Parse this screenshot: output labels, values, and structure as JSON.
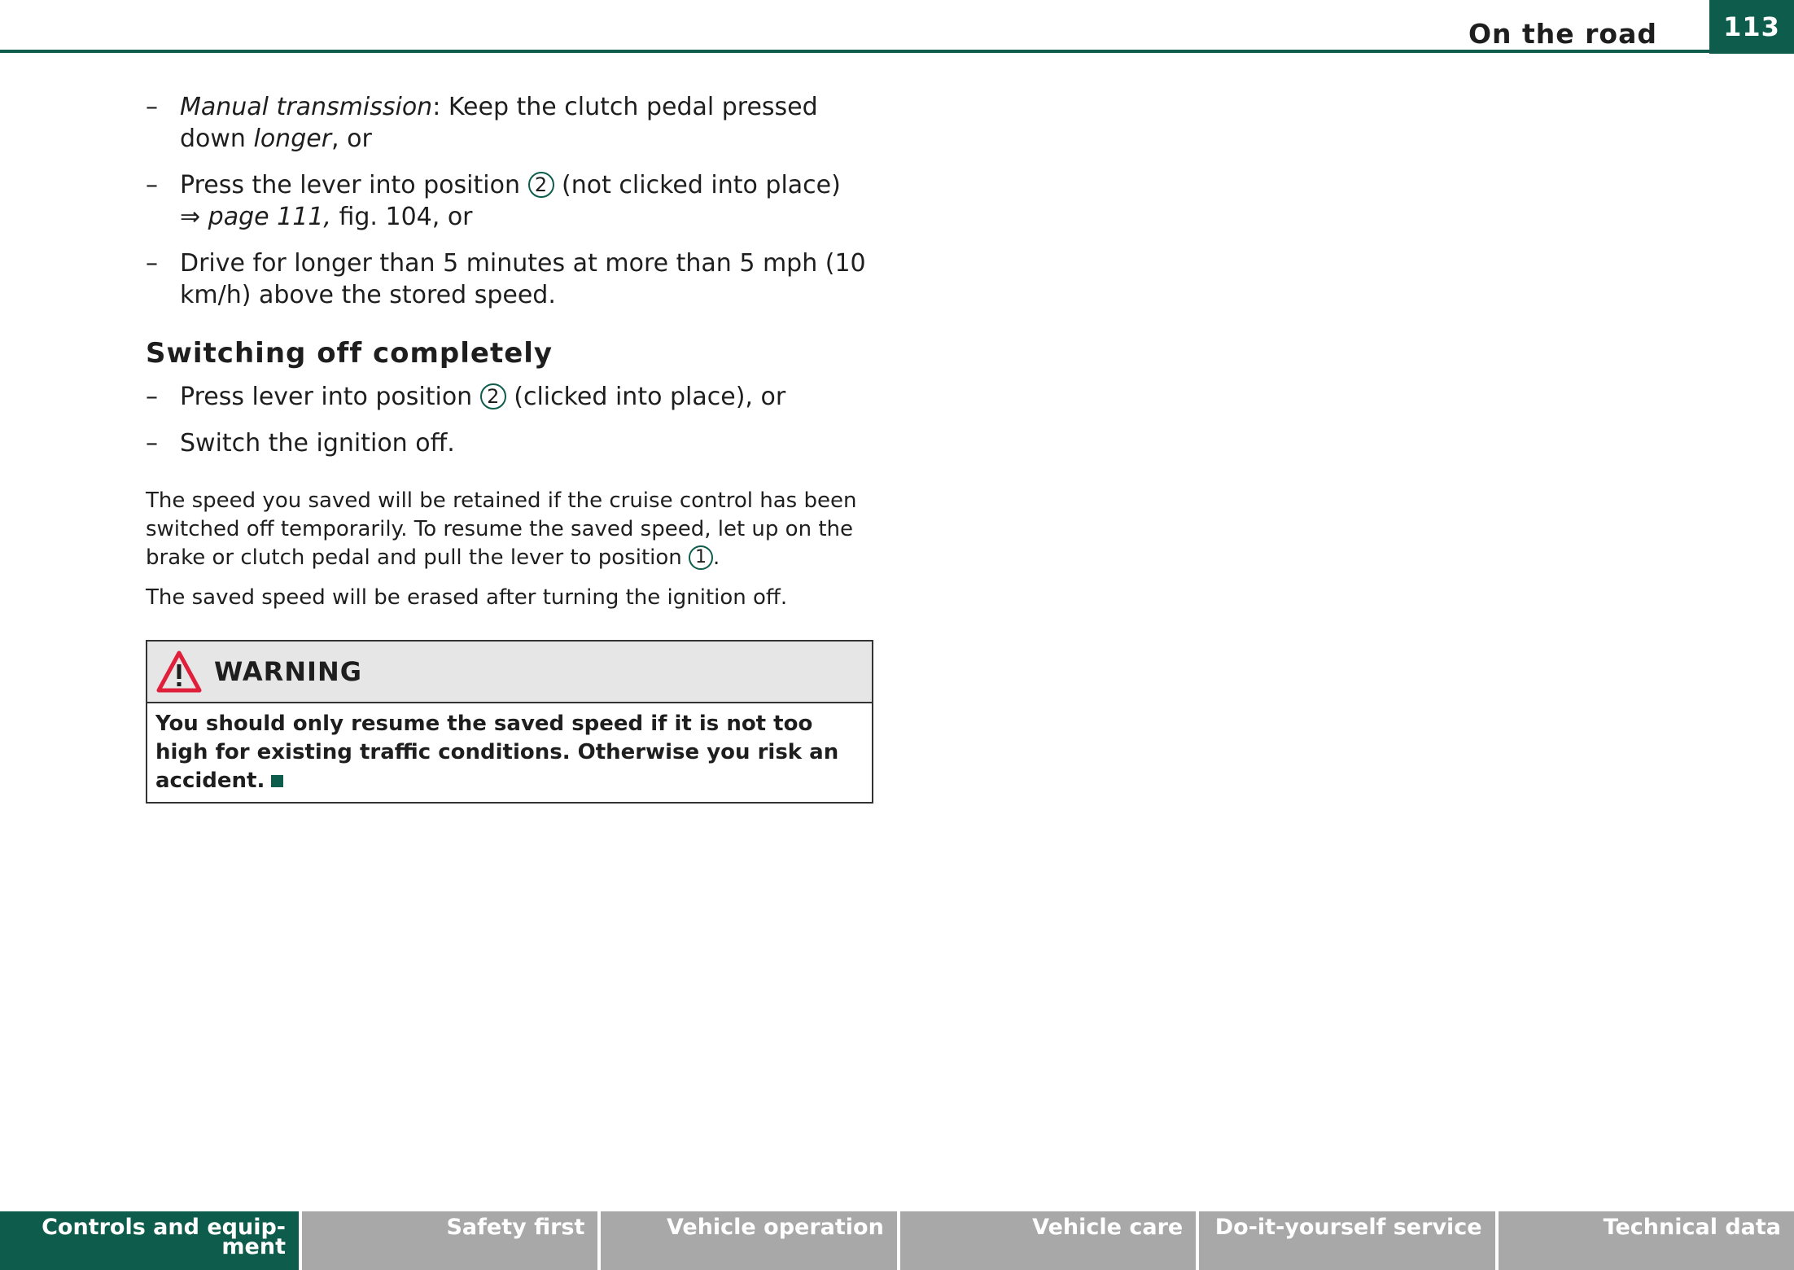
{
  "header": {
    "section_title": "On the road",
    "page_number": "113"
  },
  "list_items": {
    "item1": {
      "dash": "–",
      "italic_term": "Manual transmission",
      "text_after": ": Keep the clutch pedal pressed down ",
      "italic_word": "longer",
      "text_end": ", or"
    },
    "item2": {
      "dash": "–",
      "text_before": "Press the lever into position ",
      "position_number": "2",
      "text_after": " (not clicked into place)",
      "arrow": "⇒",
      "page_ref": " page 111,",
      "text_end": " fig. 104, or"
    },
    "item3": {
      "dash": "–",
      "text": "Drive for longer than 5 minutes at more than 5 mph (10 km/h) above the stored speed."
    }
  },
  "switching_off": {
    "heading": "Switching off completely",
    "item1": {
      "dash": "–",
      "text_before": "Press lever into position ",
      "position_number": "2",
      "text_after": " (clicked into place), or"
    },
    "item2": {
      "dash": "–",
      "text": "Switch the ignition off."
    }
  },
  "paragraphs": {
    "p1_text": "The speed you saved will be retained if the cruise control has been switched off temporarily. To resume the saved speed, let up on the brake or clutch pedal and pull the lever to position ",
    "p1_position": "1",
    "p1_end": ".",
    "p2": "The saved speed will be erased after turning the ignition off."
  },
  "warning": {
    "title": "WARNING",
    "body": "You should only resume the saved speed if it is not too high for existing traffic conditions. Otherwise you risk an accident.",
    "icon": "warning-triangle-icon",
    "icon_color": "#e0203a"
  },
  "footer_tabs": {
    "tab1_line1": "Controls and equip-",
    "tab1_line2": "ment",
    "tab2": "Safety first",
    "tab3": "Vehicle operation",
    "tab4": "Vehicle care",
    "tab5": "Do-it-yourself service",
    "tab6": "Technical data"
  },
  "colors": {
    "accent": "#0e5c4c",
    "tab_inactive": "#a8a8a8",
    "warning_header_bg": "#e6e6e6"
  }
}
